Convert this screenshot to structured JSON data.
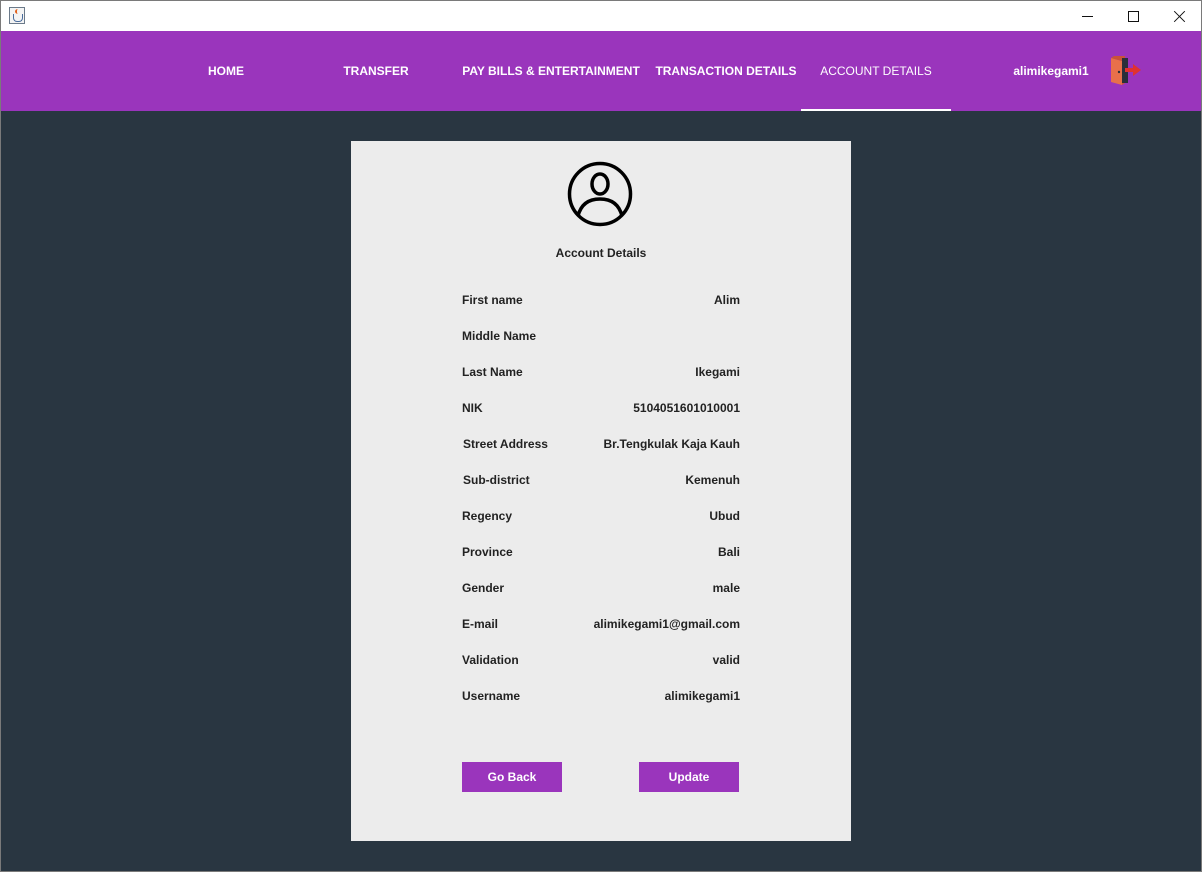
{
  "window": {
    "app_icon": "java-cup-icon",
    "controls": [
      "minimize-icon",
      "maximize-icon",
      "close-icon"
    ]
  },
  "nav": {
    "items": [
      {
        "label": "HOME"
      },
      {
        "label": "TRANSFER"
      },
      {
        "label": "PAY BILLS & ENTERTAINMENT"
      },
      {
        "label": "TRANSACTION DETAILS"
      },
      {
        "label": "ACCOUNT DETAILS",
        "active": true
      }
    ],
    "username": "alimikegami1",
    "logout_icon": "logout-door-icon"
  },
  "card": {
    "title": "Account Details",
    "avatar_icon": "user-circle-icon",
    "fields": [
      {
        "label": "First name",
        "value": "Alim"
      },
      {
        "label": "Middle Name",
        "value": ""
      },
      {
        "label": "Last Name",
        "value": "Ikegami"
      },
      {
        "label": "NIK",
        "value": "5104051601010001"
      },
      {
        "label": "Street Address",
        "value": "Br.Tengkulak Kaja Kauh"
      },
      {
        "label": "Sub-district",
        "value": "Kemenuh"
      },
      {
        "label": "Regency",
        "value": "Ubud"
      },
      {
        "label": "Province",
        "value": "Bali"
      },
      {
        "label": "Gender",
        "value": "male"
      },
      {
        "label": "E-mail",
        "value": "alimikegami1@gmail.com"
      },
      {
        "label": "Validation",
        "value": "valid"
      },
      {
        "label": "Username",
        "value": "alimikegami1"
      }
    ],
    "go_back_label": "Go Back",
    "update_label": "Update"
  },
  "colors": {
    "accent": "#9a35bc",
    "background": "#293641",
    "card": "#ececec"
  }
}
